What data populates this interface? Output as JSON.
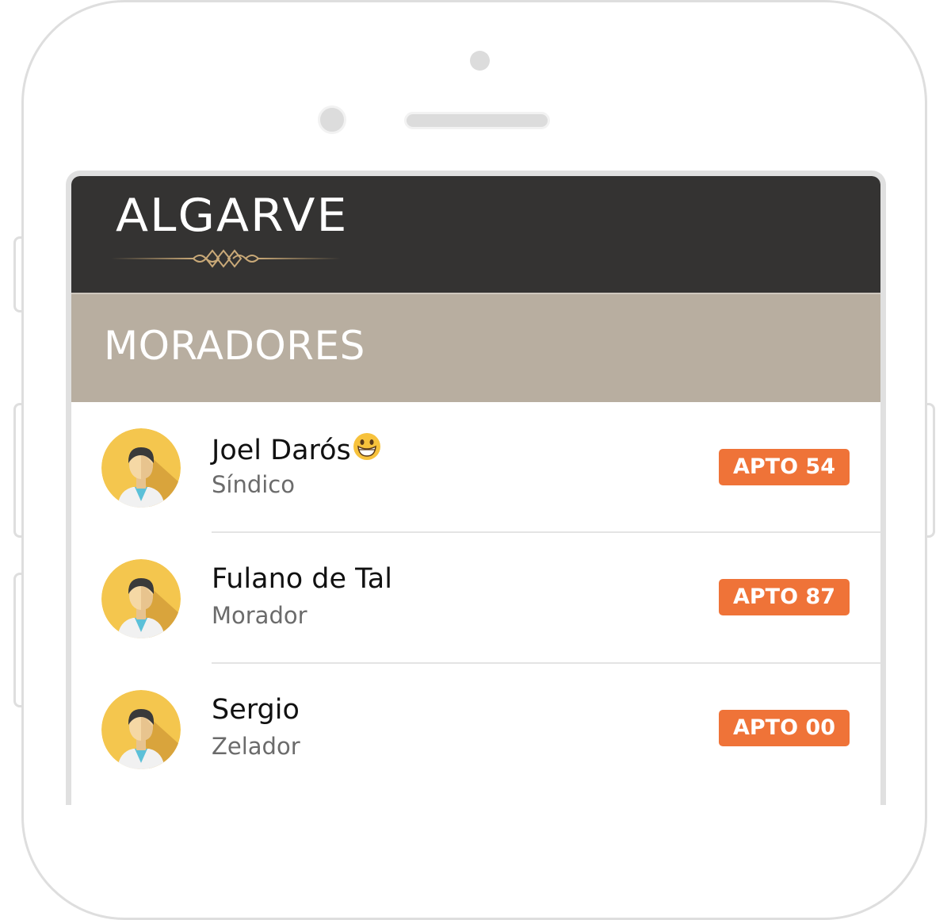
{
  "app": {
    "brand": "ALGARVE",
    "section_title": "MORADORES"
  },
  "residents": [
    {
      "name": "Joel Darós",
      "role": "Síndico",
      "apartment": "APTO 54",
      "emoji": "grinning-face-emoji",
      "avatar": "person-avatar-icon"
    },
    {
      "name": "Fulano de Tal",
      "role": "Morador",
      "apartment": "APTO 87",
      "avatar": "person-avatar-icon"
    },
    {
      "name": "Sergio",
      "role": "Zelador",
      "apartment": "APTO 00",
      "avatar": "person-avatar-icon"
    }
  ],
  "colors": {
    "header_bg": "#343332",
    "section_bg": "#b8aea0",
    "badge_bg": "#ef7338",
    "avatar_bg": "#f4c64e"
  }
}
